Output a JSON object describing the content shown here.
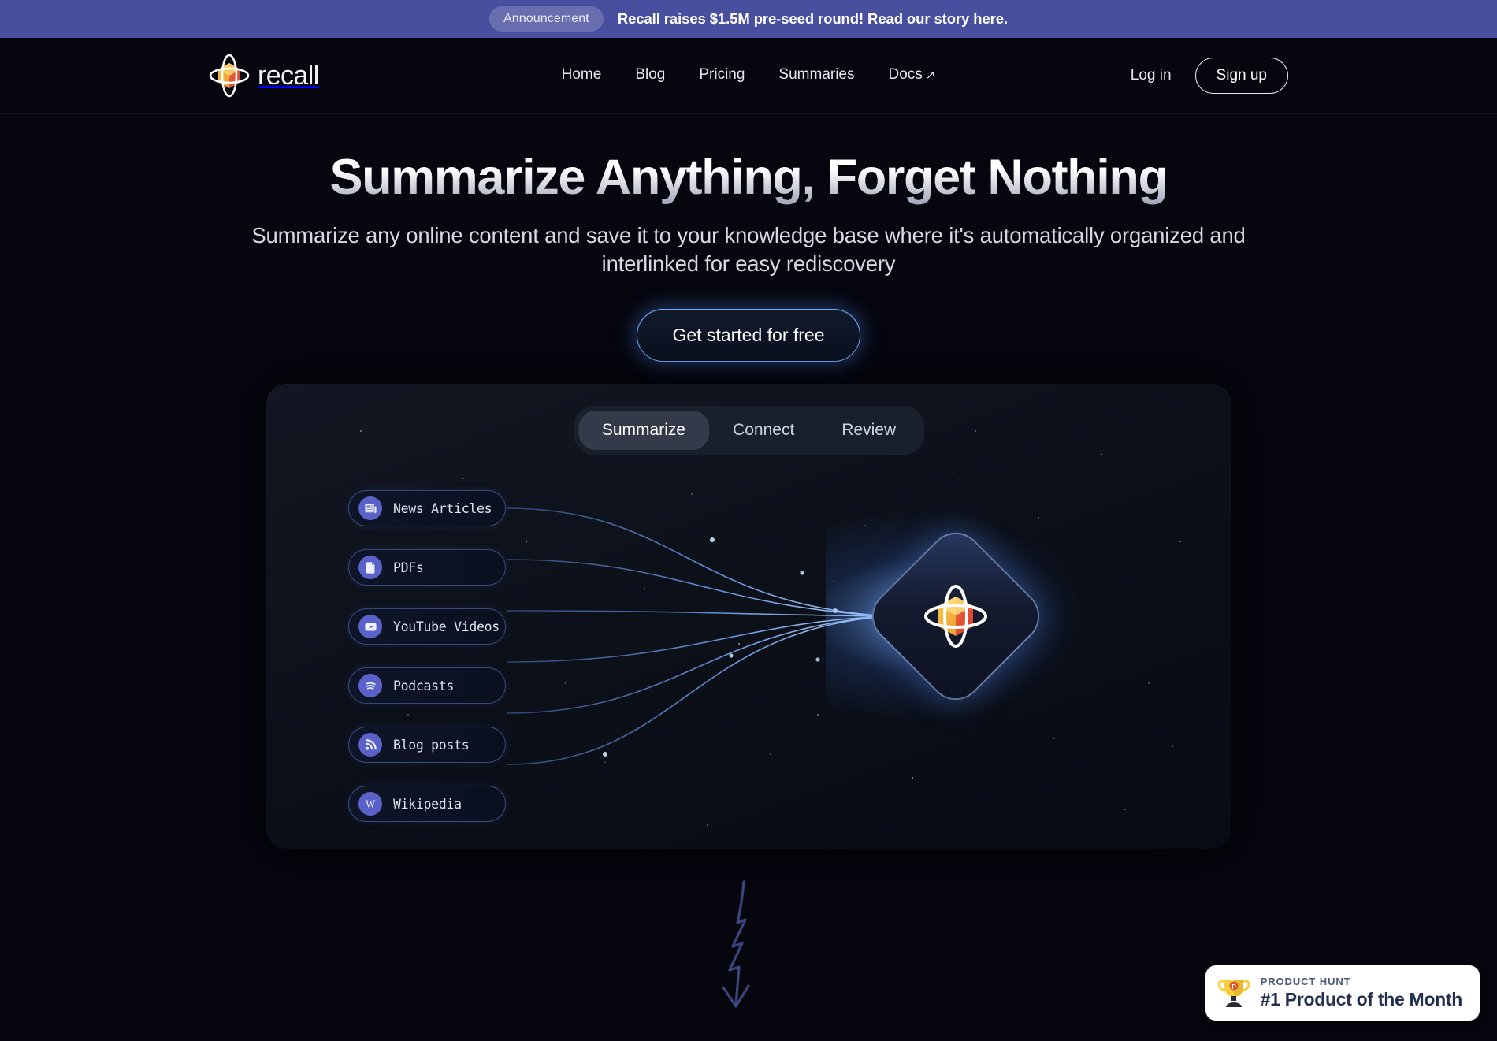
{
  "announcement": {
    "badge_label": "Announcement",
    "message": "Recall raises $1.5M pre-seed round! Read our story here.",
    "bg_color": "#474f9e"
  },
  "header": {
    "brand": "recall",
    "logo_icon": "recall-orbit-cube-logo",
    "nav": [
      {
        "label": "Home",
        "icon": null
      },
      {
        "label": "Blog",
        "icon": null
      },
      {
        "label": "Pricing",
        "icon": null
      },
      {
        "label": "Summaries",
        "icon": null
      },
      {
        "label": "Docs",
        "icon": "external-link-arrow",
        "suffix": "↗"
      }
    ],
    "login_label": "Log in",
    "signup_label": "Sign up"
  },
  "hero": {
    "title": "Summarize Anything, Forget Nothing",
    "subtitle": "Summarize any online content and save it to your knowledge base where it's automatically organized and interlinked for easy rediscovery",
    "cta_label": "Get started for free",
    "cta_accent": "#6fa8f0"
  },
  "demo": {
    "tabs": [
      {
        "label": "Summarize",
        "active": true
      },
      {
        "label": "Connect",
        "active": false
      },
      {
        "label": "Review",
        "active": false
      }
    ],
    "sources": [
      {
        "label": "News Articles",
        "icon": "newspaper-icon"
      },
      {
        "label": "PDFs",
        "icon": "pdf-document-icon"
      },
      {
        "label": "YouTube Videos",
        "icon": "youtube-play-icon"
      },
      {
        "label": "Podcasts",
        "icon": "spotify-podcast-icon"
      },
      {
        "label": "Blog posts",
        "icon": "rss-feed-icon"
      },
      {
        "label": "Wikipedia",
        "icon": "wikipedia-w-icon"
      }
    ],
    "target_icon": "recall-orbit-cube-diamond",
    "pill_accent": "#5a62c9",
    "wire_color": "#5e8fd8"
  },
  "scroll_hint": {
    "icon": "zigzag-down-arrow"
  },
  "product_hunt": {
    "kicker": "PRODUCT HUNT",
    "title": "#1 Product of the Month",
    "icon": "trophy-icon"
  }
}
